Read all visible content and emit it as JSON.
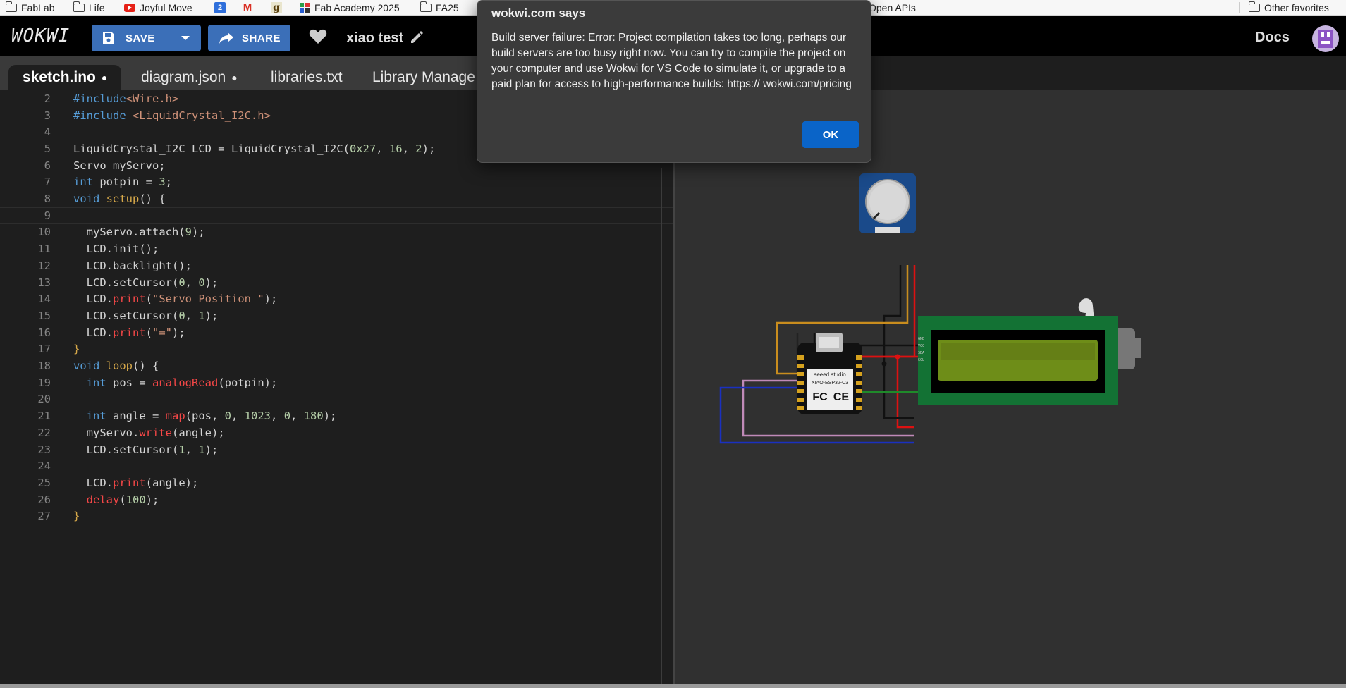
{
  "bookmarks": [
    {
      "label": "FabLab",
      "icon": "folder-icon"
    },
    {
      "label": "Life",
      "icon": "folder-icon"
    },
    {
      "label": "Joyful Move",
      "icon": "youtube-icon"
    },
    {
      "label": "",
      "icon": "calendar-icon"
    },
    {
      "label": "",
      "icon": "gmail-icon"
    },
    {
      "label": "",
      "icon": "goodreads-icon"
    },
    {
      "label": "Fab Academy 2025",
      "icon": "fab-academy-icon"
    },
    {
      "label": "FA25",
      "icon": "folder-icon"
    },
    {
      "label": "Open APIs",
      "icon": "folder-icon"
    },
    {
      "label": "Other favorites",
      "icon": "folder-icon"
    }
  ],
  "header": {
    "logo": "WOKWI",
    "save_label": "SAVE",
    "share_label": "SHARE",
    "project_name": "xiao test",
    "docs_label": "Docs"
  },
  "tabs": [
    {
      "label": "sketch.ino",
      "modified": "●"
    },
    {
      "label": "diagram.json",
      "modified": "●"
    },
    {
      "label": "libraries.txt",
      "modified": ""
    },
    {
      "label": "Library Manage",
      "modified": ""
    }
  ],
  "editor": {
    "line_numbers": [
      "2",
      "3",
      "4",
      "5",
      "6",
      "7",
      "8",
      "9",
      "10",
      "11",
      "12",
      "13",
      "14",
      "15",
      "16",
      "17",
      "18",
      "19",
      "20",
      "21",
      "22",
      "23",
      "24",
      "25",
      "26",
      "27"
    ]
  },
  "dialog": {
    "title": "wokwi.com says",
    "message": "Build server failure: Error: Project compilation takes too long, perhaps our build servers are too busy right now. You can try to compile the project on your computer and use Wokwi for VS Code to simulate it, or upgrade to a paid plan for access to high-performance builds: https:// wokwi.com/pricing",
    "ok_label": "OK"
  },
  "simulation": {
    "board_brand": "seeed studio",
    "board_label": "XIAO-ESP32-C3",
    "fc_mark": "FC",
    "ce_mark": "CE",
    "lcd_pins": [
      "GND",
      "VCC",
      "SDA",
      "SCL"
    ]
  }
}
